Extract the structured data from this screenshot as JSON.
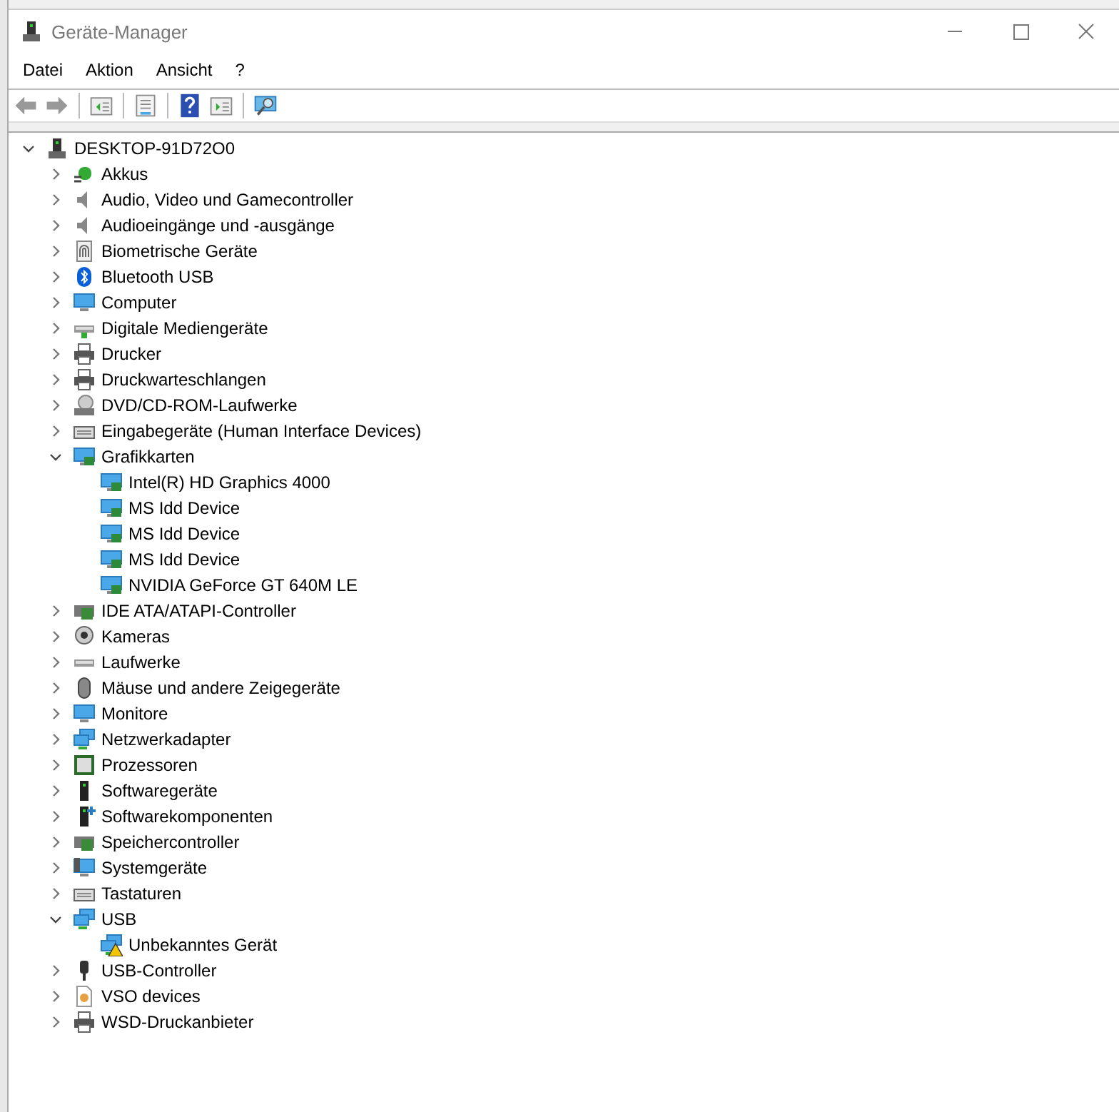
{
  "window": {
    "title": "Geräte-Manager"
  },
  "menu": [
    "Datei",
    "Aktion",
    "Ansicht",
    "?"
  ],
  "tree": {
    "label": "DESKTOP-91D72O0",
    "kind": "computer-root",
    "expanded": true,
    "children": [
      {
        "label": "Akkus",
        "kind": "battery",
        "expanded": false
      },
      {
        "label": "Audio, Video und Gamecontroller",
        "kind": "speaker",
        "expanded": false
      },
      {
        "label": "Audioeingänge und -ausgänge",
        "kind": "speaker",
        "expanded": false
      },
      {
        "label": "Biometrische Geräte",
        "kind": "fingerprint",
        "expanded": false
      },
      {
        "label": "Bluetooth USB",
        "kind": "bluetooth",
        "expanded": false
      },
      {
        "label": "Computer",
        "kind": "monitor",
        "expanded": false
      },
      {
        "label": "Digitale Mediengeräte",
        "kind": "media",
        "expanded": false
      },
      {
        "label": "Drucker",
        "kind": "printer",
        "expanded": false
      },
      {
        "label": "Druckwarteschlangen",
        "kind": "printer",
        "expanded": false
      },
      {
        "label": "DVD/CD-ROM-Laufwerke",
        "kind": "disc",
        "expanded": false
      },
      {
        "label": "Eingabegeräte (Human Interface Devices)",
        "kind": "hid",
        "expanded": false
      },
      {
        "label": "Grafikkarten",
        "kind": "display",
        "expanded": true,
        "children": [
          {
            "label": "Intel(R) HD Graphics 4000",
            "kind": "display"
          },
          {
            "label": "MS Idd Device",
            "kind": "display"
          },
          {
            "label": "MS Idd Device",
            "kind": "display"
          },
          {
            "label": "MS Idd Device",
            "kind": "display"
          },
          {
            "label": "NVIDIA GeForce GT 640M LE",
            "kind": "display"
          }
        ]
      },
      {
        "label": "IDE ATA/ATAPI-Controller",
        "kind": "card",
        "expanded": false
      },
      {
        "label": "Kameras",
        "kind": "camera",
        "expanded": false
      },
      {
        "label": "Laufwerke",
        "kind": "drive",
        "expanded": false
      },
      {
        "label": "Mäuse und andere Zeigegeräte",
        "kind": "mouse",
        "expanded": false
      },
      {
        "label": "Monitore",
        "kind": "monitor",
        "expanded": false
      },
      {
        "label": "Netzwerkadapter",
        "kind": "network",
        "expanded": false
      },
      {
        "label": "Prozessoren",
        "kind": "chip",
        "expanded": false
      },
      {
        "label": "Softwaregeräte",
        "kind": "tower",
        "expanded": false
      },
      {
        "label": "Softwarekomponenten",
        "kind": "tower-plus",
        "expanded": false
      },
      {
        "label": "Speichercontroller",
        "kind": "storage",
        "expanded": false
      },
      {
        "label": "Systemgeräte",
        "kind": "system",
        "expanded": false
      },
      {
        "label": "Tastaturen",
        "kind": "keyboard",
        "expanded": false
      },
      {
        "label": "USB",
        "kind": "network",
        "expanded": true,
        "children": [
          {
            "label": "Unbekanntes Gerät",
            "kind": "network",
            "warning": true
          }
        ]
      },
      {
        "label": "USB-Controller",
        "kind": "plug",
        "expanded": false
      },
      {
        "label": "VSO devices",
        "kind": "document",
        "expanded": false
      },
      {
        "label": "WSD-Druckanbieter",
        "kind": "printer",
        "expanded": false
      }
    ]
  }
}
